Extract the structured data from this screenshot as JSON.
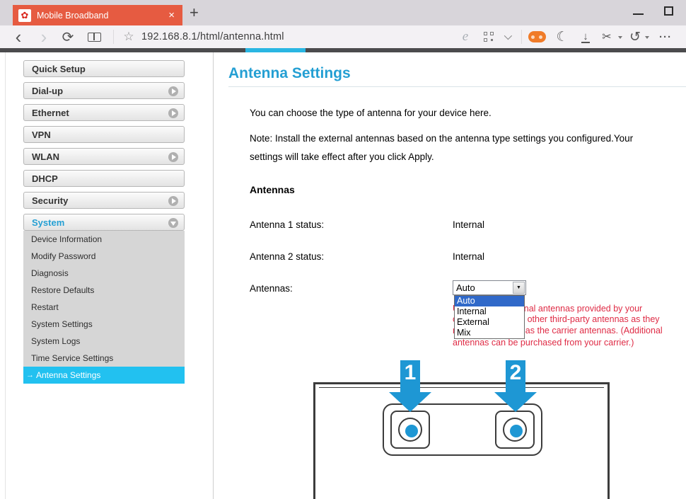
{
  "browser": {
    "tab_title": "Mobile Broadband",
    "url": "192.168.8.1/html/antenna.html"
  },
  "icons": {
    "flower": "✿",
    "close": "×",
    "plus": "+",
    "back": "‹",
    "forward": "›",
    "refresh": "⟳",
    "star": "☆",
    "ie": "e",
    "moon": "☾",
    "download": "↓",
    "scissors": "✂",
    "undo": "↺",
    "ellipsis": "···",
    "arrow_prefix": "→",
    "select_arrow": "▼"
  },
  "sidebar": {
    "items": [
      {
        "label": "Quick Setup",
        "arrow": "none"
      },
      {
        "label": "Dial-up",
        "arrow": "right"
      },
      {
        "label": "Ethernet",
        "arrow": "right"
      },
      {
        "label": "VPN",
        "arrow": "none"
      },
      {
        "label": "WLAN",
        "arrow": "right"
      },
      {
        "label": "DHCP",
        "arrow": "none"
      },
      {
        "label": "Security",
        "arrow": "right"
      },
      {
        "label": "System",
        "arrow": "down",
        "active": true
      }
    ],
    "submenu": [
      "Device Information",
      "Modify Password",
      "Diagnosis",
      "Restore Defaults",
      "Restart",
      "System Settings",
      "System Logs",
      "Time Service Settings"
    ],
    "selected": {
      "label": "Antenna Settings"
    }
  },
  "content": {
    "title": "Antenna Settings",
    "intro": "You can choose the type of antenna for your device here.",
    "note_lines": [
      "Note: Install the external antennas based on the antenna type settings you configured.Your",
      "settings will take effect after you click Apply."
    ],
    "section_title": "Antennas",
    "rows": [
      {
        "label": "Antenna 1 status:",
        "value": "Internal"
      },
      {
        "label": "Antenna 2 status:",
        "value": "Internal"
      },
      {
        "label": "Antennas:"
      }
    ],
    "dropdown": {
      "selected": "Auto",
      "options": [
        "Auto",
        "Internal",
        "External",
        "Mix"
      ]
    },
    "warning_lines": [
      "Use only the external antennas provided by your",
      "carrier. Do not use other third-party antennas as they",
      "may not work well as the carrier antennas. (Additional",
      "antennas can be purchased from your carrier.)"
    ],
    "diagram": {
      "labels": [
        "1",
        "2"
      ]
    }
  },
  "colors": {
    "accent_blue": "#249fd3",
    "selected_cyan": "#22c1f0",
    "tab_red": "#e65b41",
    "warning_red": "#df2b45",
    "arrow_blue": "#1e97d4",
    "highlight_blue": "#3069c9",
    "progress_cyan": "#2ab6e2"
  }
}
